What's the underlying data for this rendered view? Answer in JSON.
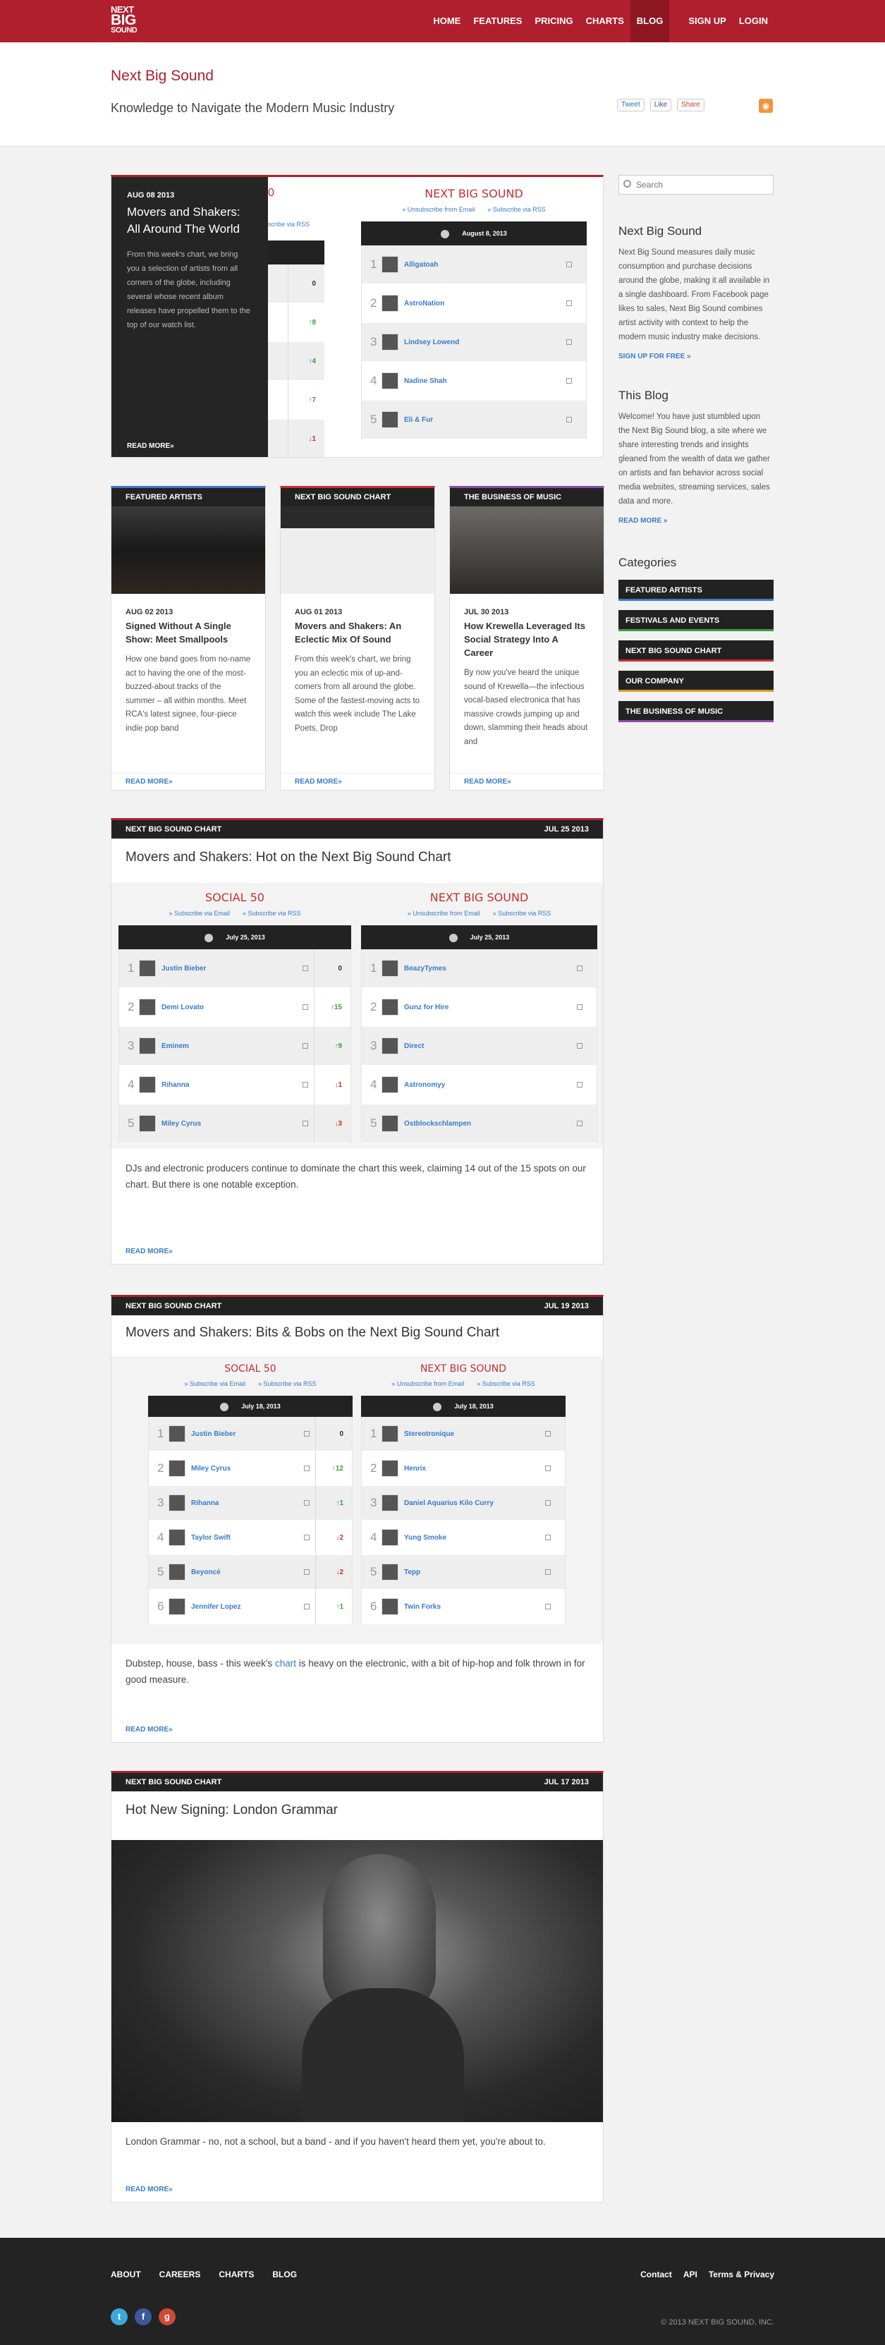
{
  "nav": {
    "logo": [
      "NEXT",
      "BIG",
      "SOUND"
    ],
    "items": [
      "HOME",
      "FEATURES",
      "PRICING",
      "CHARTS",
      "BLOG"
    ],
    "signup": "SIGN UP",
    "login": "LOGIN"
  },
  "hero": {
    "title": "Next Big Sound",
    "subtitle": "Knowledge to Navigate the Modern Music Industry",
    "tweet": "Tweet",
    "like": "Like",
    "share": "Share"
  },
  "feature": {
    "date": "AUG 08 2013",
    "title": "Movers and Shakers: All Around The World",
    "text": "From this week's chart, we bring you a selection of artists from all corners of the globe, including several whose recent album releases have propelled them to the top of our watch list.",
    "readmore": "READ MORE»",
    "chart_title": "NEXT BIG SOUND",
    "partial_title": "0",
    "sub_left": "scribe via RSS",
    "sub1": "» Unsubscribe from Email",
    "sub2": "» Subscribe via RSS",
    "date_label": "August 8, 2013",
    "left_changes": [
      "0",
      "↑8",
      "↑4",
      "↑7",
      "↓1"
    ],
    "names": [
      "Alligatoah",
      "AstroNation",
      "Lindsey Lowend",
      "Nadine Shah",
      "Eli & Fur"
    ]
  },
  "cards": [
    {
      "cat": "FEATURED ARTISTS",
      "date": "AUG 02 2013",
      "title": "Signed Without A Single Show: Meet Smallpools",
      "text": "How one band goes from no-name act to having the one of the most-buzzed-about tracks of the summer – all within months. Meet RCA's latest signee, four-piece indie pop band",
      "readmore": "READ MORE»"
    },
    {
      "cat": "NEXT BIG SOUND CHART",
      "date": "AUG 01 2013",
      "title": "Movers and Shakers: An Eclectic Mix Of Sound",
      "text": "From this week's chart, we bring you an eclectic mix of up-and-comers from all around the globe. Some of the fastest-moving acts to watch this week include The Lake Poets, Drop",
      "readmore": "READ MORE»"
    },
    {
      "cat": "THE BUSINESS OF MUSIC",
      "date": "JUL 30 2013",
      "title": "How Krewella Leveraged Its Social Strategy Into A Career",
      "text": "By now you've heard the unique sound of Krewella—the infectious vocal-based electronica that has massive crowds jumping up and down, slamming their heads about and",
      "readmore": "READ MORE»"
    }
  ],
  "post1": {
    "cat": "NEXT BIG SOUND CHART",
    "date": "JUL 25 2013",
    "title": "Movers and Shakers: Hot on the Next Big Sound Chart",
    "left_title": "SOCIAL 50",
    "right_title": "NEXT BIG SOUND",
    "sub_l1": "» Subscribe via Email",
    "sub_l2": "» Subscribe via RSS",
    "sub_r1": "» Unsubscribe from Email",
    "sub_r2": "» Subscribe via RSS",
    "chart_date": "July 25, 2013",
    "left": [
      {
        "n": "Justin Bieber",
        "c": "0"
      },
      {
        "n": "Demi Lovato",
        "c": "↑15"
      },
      {
        "n": "Eminem",
        "c": "↑9"
      },
      {
        "n": "Rihanna",
        "c": "↓1"
      },
      {
        "n": "Miley Cyrus",
        "c": "↓3"
      }
    ],
    "right": [
      "BeazyTymes",
      "Gunz for Hire",
      "Direct",
      "Astronomyy",
      "Ostblockschlampen"
    ],
    "excerpt": "DJs and electronic producers continue to dominate the chart this week, claiming 14 out of the 15 spots on our chart. But there is one notable exception.",
    "readmore": "READ MORE»"
  },
  "post2": {
    "cat": "NEXT BIG SOUND CHART",
    "date": "JUL 19 2013",
    "title": "Movers and Shakers: Bits & Bobs on the Next Big Sound Chart",
    "left_title": "SOCIAL 50",
    "right_title": "NEXT BIG SOUND",
    "sub_l1": "» Subscribe via Email",
    "sub_l2": "» Subscribe via RSS",
    "sub_r1": "» Unsubscribe from Email",
    "sub_r2": "» Subscribe via RSS",
    "chart_date": "July 18, 2013",
    "left": [
      {
        "n": "Justin Bieber",
        "c": "0"
      },
      {
        "n": "Miley Cyrus",
        "c": "↑12"
      },
      {
        "n": "Rihanna",
        "c": "↑1"
      },
      {
        "n": "Taylor Swift",
        "c": "↓2"
      },
      {
        "n": "Beyoncé",
        "c": "↓2"
      },
      {
        "n": "Jennifer Lopez",
        "c": "↑1"
      }
    ],
    "right": [
      "Stereotronique",
      "Henrix",
      "Daniel Aquarius Kilo Curry",
      "Yung Smoke",
      "Tepp",
      "Twin Forks"
    ],
    "excerpt_a": "Dubstep, house, bass - this week's ",
    "excerpt_link": "chart",
    "excerpt_b": " is heavy on the electronic, with a bit of hip-hop and folk thrown in for good measure.",
    "readmore": "READ MORE»"
  },
  "post3": {
    "cat": "NEXT BIG SOUND CHART",
    "date": "JUL 17 2013",
    "title": "Hot New Signing: London Grammar",
    "excerpt": "London Grammar - no, not a school, but a band -  and if you haven't heard them yet, you're about to.",
    "readmore": "READ MORE»"
  },
  "sidebar": {
    "search_placeholder": "Search",
    "about_title": "Next Big Sound",
    "about_text": "Next Big Sound measures daily music consumption and purchase decisions around the globe, making it all available in a single dashboard. From Facebook page likes to sales, Next Big Sound combines artist activity with context to help the modern music industry make decisions.",
    "signup": "SIGN UP FOR FREE »",
    "blog_title": "This Blog",
    "blog_text": "Welcome! You have just stumbled upon the Next Big Sound blog, a site where we share interesting trends and insights gleaned from the wealth of data we gather on artists and fan behavior across social media websites, streaming services, sales data and more.",
    "blog_more": "READ MORE »",
    "cat_title": "Categories",
    "categories": [
      {
        "label": "FEATURED ARTISTS",
        "color": "#3a7bc8"
      },
      {
        "label": "FESTIVALS AND EVENTS",
        "color": "#3f9a3f"
      },
      {
        "label": "NEXT BIG SOUND CHART",
        "color": "#c4302f"
      },
      {
        "label": "OUR COMPANY",
        "color": "#e09a2e"
      },
      {
        "label": "THE BUSINESS OF MUSIC",
        "color": "#8a4ca8"
      }
    ]
  },
  "footer": {
    "links": [
      "ABOUT",
      "CAREERS",
      "CHARTS",
      "BLOG"
    ],
    "right": [
      "Contact",
      "API",
      "Terms & Privacy"
    ],
    "copy": "© 2013 NEXT BIG SOUND, INC.",
    "icons": [
      "t",
      "f",
      "g"
    ]
  }
}
